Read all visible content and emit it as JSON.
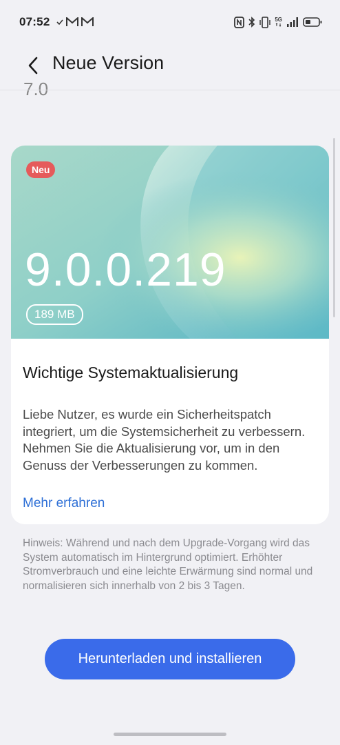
{
  "status_bar": {
    "time": "07:52",
    "left_icons": [
      "check-icon",
      "gmail-icon",
      "gmail-icon"
    ],
    "right_icons": [
      "nfc-icon",
      "bluetooth-icon",
      "vibrate-icon",
      "5g-icon",
      "signal-icon",
      "battery-icon"
    ],
    "network_label": "5G"
  },
  "header": {
    "title": "Neue Version",
    "previous_version_partial": "7.0"
  },
  "card": {
    "badge": "Neu",
    "version": "9.0.0.219",
    "size": "189 MB",
    "title": "Wichtige Systemaktualisierung",
    "description": "Liebe Nutzer, es wurde ein Sicherheitspatch integriert, um die Systemsicherheit zu verbessern. Nehmen Sie die Aktualisierung vor, um in den Genuss der Verbesserungen zu kommen.",
    "learn_more": "Mehr erfahren"
  },
  "note": "Hinweis: Während und nach dem Upgrade-Vorgang wird das System automatisch im Hintergrund optimiert. Erhöhter Stromverbrauch und eine leichte Erwärmung sind normal und normalisieren sich innerhalb von 2 bis 3 Tagen.",
  "download_button": "Herunterladen und installieren",
  "colors": {
    "accent": "#3a6bea",
    "link": "#2d6fd6",
    "badge_red": "#e55b5b",
    "background": "#f1f1f5"
  }
}
